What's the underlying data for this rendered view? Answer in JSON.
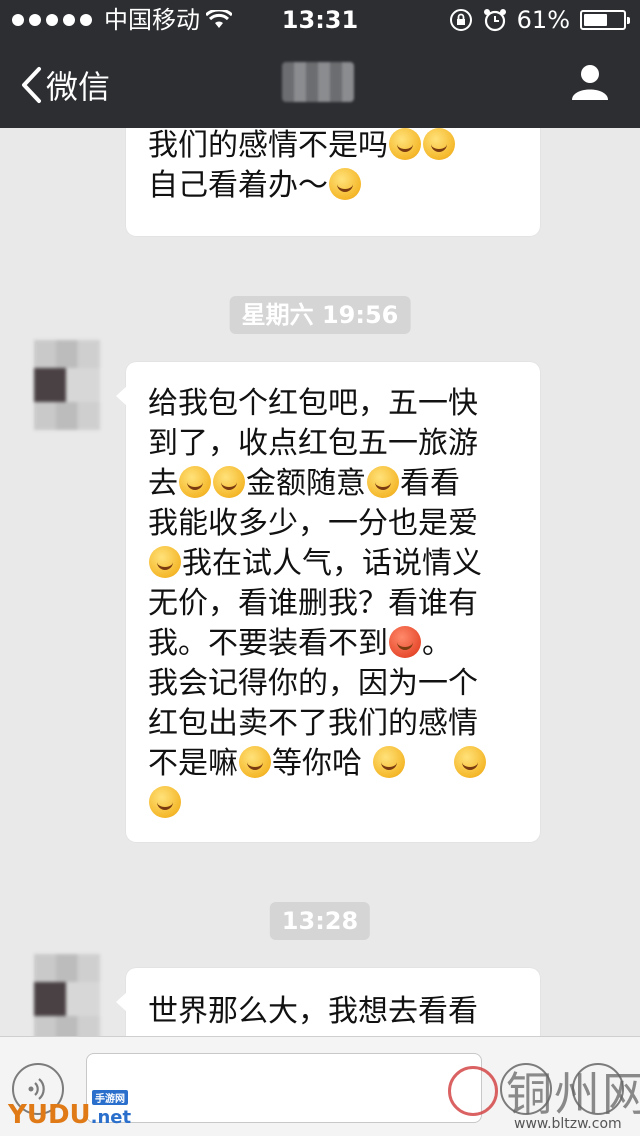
{
  "status_bar": {
    "carrier": "中国移动",
    "time": "13:31",
    "battery": "61%",
    "battery_level": 0.61
  },
  "nav": {
    "back_label": "微信"
  },
  "messages": [
    {
      "lines": [
        "我们的感情不是吗",
        "自己看着办～"
      ],
      "partial_top": true
    },
    {
      "lines": [
        " 给我包个红包吧，五一快",
        "到了，收点红包五一旅游",
        "去  金额随意 看看",
        "我能收多少，一分也是爱",
        " 我在试人气，话说情义",
        "无价，看谁删我？看谁有",
        "我。不要装看不到 。",
        "我会记得你的，因为一个",
        "红包出卖不了我们的感情",
        "不是嘛 等你哈"
      ]
    },
    {
      "lines": [
        "世界那么大，我想去看看"
      ]
    }
  ],
  "timestamps": [
    "星期六 19:56",
    "13:28"
  ],
  "watermarks": {
    "left": "YUDU",
    "left_suffix": ".net",
    "left_tag": "手游网",
    "right_cn": "铜州网",
    "right_url": "www.bltzw.com"
  }
}
